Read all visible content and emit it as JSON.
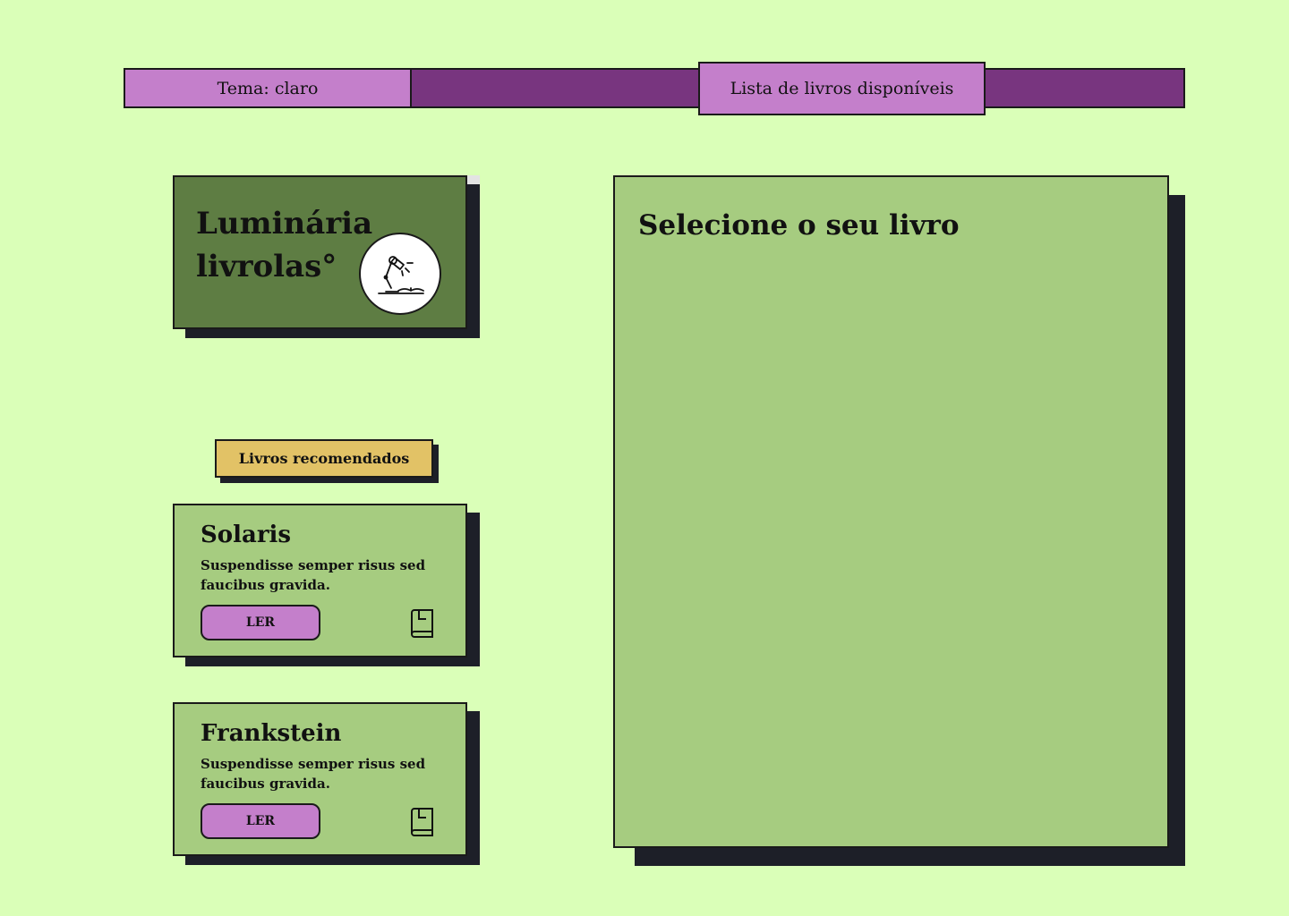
{
  "header": {
    "theme_tab": "Tema: claro",
    "list_tab": "Lista de livros disponíveis"
  },
  "logo": {
    "line1": "Luminária",
    "line2": "livrolas°",
    "icon": "desk-lamp-book-icon"
  },
  "recommended": {
    "label": "Livros recomendados",
    "books": [
      {
        "title": "Solaris",
        "description": "Suspendisse semper risus sed faucibus gravida.",
        "button": "LER",
        "icon": "book-icon"
      },
      {
        "title": "Frankstein",
        "description": "Suspendisse semper risus sed faucibus gravida.",
        "button": "LER",
        "icon": "book-icon"
      }
    ]
  },
  "main": {
    "title": "Selecione o seu livro"
  },
  "colors": {
    "background": "#daffb8",
    "purple_light": "#c47fcb",
    "purple_dark": "#78357f",
    "green_dark": "#5e7d43",
    "green_light": "#a6cc80",
    "yellow": "#e2c266",
    "shadow": "#1d1f28"
  }
}
